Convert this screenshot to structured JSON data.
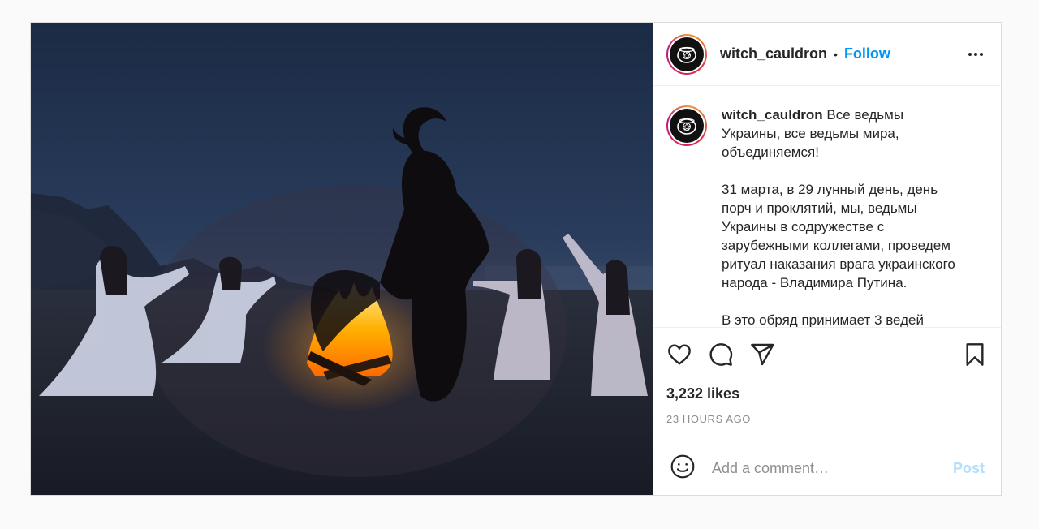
{
  "post": {
    "image_alt": "Women in white kneeling around a bonfire on a dark beach with a horned figure in black",
    "header": {
      "username": "witch_cauldron",
      "separator": "•",
      "follow_label": "Follow",
      "more_icon": "more-horizontal-icon"
    },
    "caption": {
      "username": "witch_cauldron",
      "lines": [
        "Все ведьмы",
        "Украины, все ведьмы мира,",
        "объединяемся!",
        "",
        "31 марта, в 29 лунный день, день",
        "порч и проклятий, мы, ведьмы",
        "Украины в содружестве с",
        "зарубежными коллегами, проведем",
        "ритуал наказания врага украинского",
        "народа - Владимира Путина.",
        "",
        "В это обряд принимает 3 ведей"
      ]
    },
    "actions": {
      "like_icon": "heart-icon",
      "comment_icon": "comment-icon",
      "share_icon": "send-icon",
      "save_icon": "bookmark-icon"
    },
    "likes": "3,232 likes",
    "timestamp": "23 HOURS AGO",
    "comment": {
      "emoji_icon": "smiley-icon",
      "placeholder": "Add a comment…",
      "post_label": "Post"
    }
  },
  "colors": {
    "link_blue": "#0095f6",
    "post_disabled": "#b2dffc",
    "muted_text": "#8e8e8e",
    "border": "#dbdbdb"
  }
}
